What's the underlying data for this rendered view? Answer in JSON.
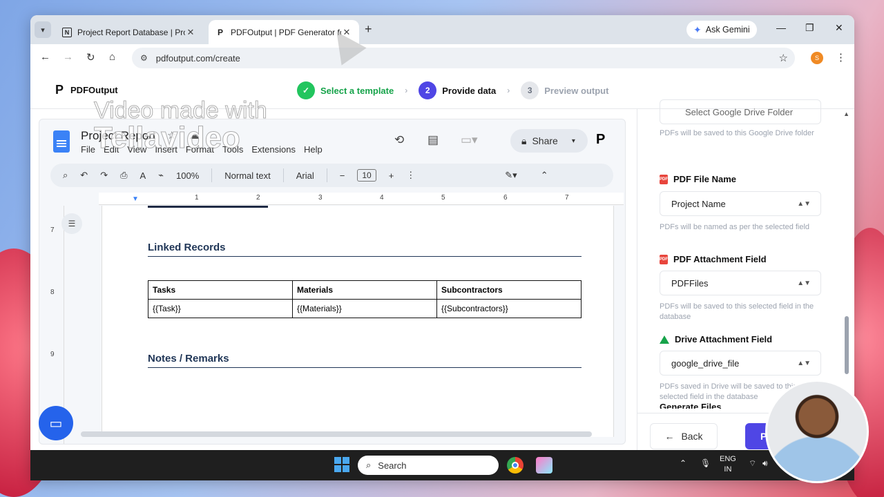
{
  "browser": {
    "tabs": [
      {
        "favicon": "notion-icon",
        "title": "Project Report Database | Proje",
        "active": false
      },
      {
        "favicon": "pdfoutput-icon",
        "title": "PDFOutput | PDF Generator for",
        "active": true
      }
    ],
    "ask_gemini": "Ask Gemini",
    "url": "pdfoutput.com/create",
    "profile_initial": "S"
  },
  "app": {
    "brand": "PDFOutput",
    "steps": [
      {
        "number": "✓",
        "label": "Select a template",
        "state": "done"
      },
      {
        "number": "2",
        "label": "Provide data",
        "state": "active"
      },
      {
        "number": "3",
        "label": "Preview output",
        "state": "todo"
      }
    ]
  },
  "doc": {
    "title": "Project Report",
    "menus": [
      "File",
      "Edit",
      "View",
      "Insert",
      "Format",
      "Tools",
      "Extensions",
      "Help"
    ],
    "share_label": "Share",
    "zoom": "100%",
    "style": "Normal text",
    "font": "Arial",
    "font_size": "10",
    "ruler_marks": [
      "1",
      "2",
      "3",
      "4",
      "5",
      "6",
      "7"
    ],
    "vruler_marks": [
      "7",
      "8",
      "9"
    ],
    "linked_records_heading": "Linked Records",
    "table_headers": [
      "Tasks",
      "Materials",
      "Subcontractors"
    ],
    "table_row": [
      "{{Task}}",
      "{{Materials}}",
      "{{Subcontractors}}"
    ],
    "notes_heading": "Notes / Remarks"
  },
  "panel": {
    "drive_folder_select": "Select Google Drive Folder",
    "drive_folder_help": "PDFs will be saved to this Google Drive folder",
    "pdf_file_name_label": "PDF File Name",
    "pdf_file_name_value": "Project Name",
    "pdf_file_name_help": "PDFs will be named as per the selected field",
    "pdf_attachment_label": "PDF Attachment Field",
    "pdf_attachment_value": "PDFFiles",
    "pdf_attachment_help": "PDFs will be saved to this selected field in the database",
    "drive_attachment_label": "Drive Attachment Field",
    "drive_attachment_value": "google_drive_file",
    "drive_attachment_help": "PDFs saved in Drive will be saved to this selected field in the database",
    "cut_field_label": "Generate Files",
    "back_label": "Back",
    "primary_label": "P"
  },
  "overlay": {
    "watermark_line1": "Video made with",
    "watermark_line2": "Tellavideo"
  },
  "taskbar": {
    "search_label": "Search",
    "lang_line1": "ENG",
    "lang_line2": "IN"
  }
}
